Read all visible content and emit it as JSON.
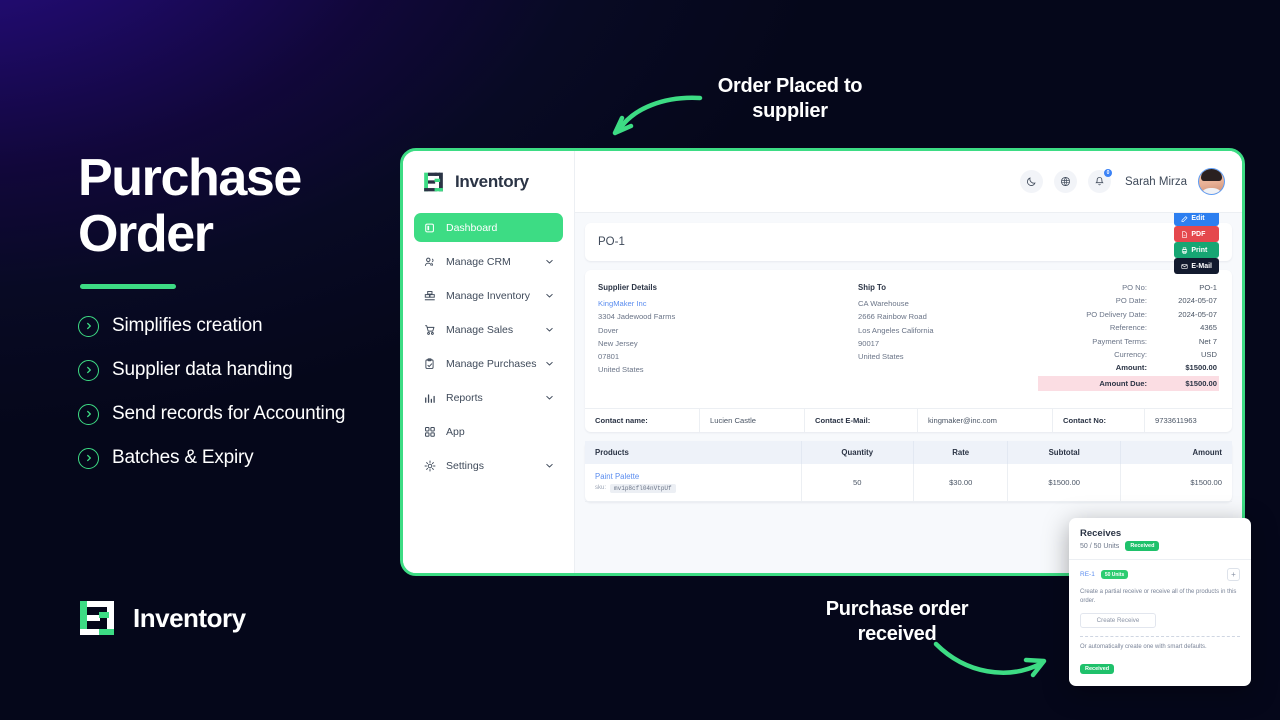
{
  "hero": {
    "title_line1": "Purchase",
    "title_line2": "Order",
    "features": [
      "Simplifies creation",
      "Supplier data handing",
      "Send records for Accounting",
      "Batches & Expiry"
    ]
  },
  "brand": {
    "name": "Inventory"
  },
  "annotations": {
    "top": "Order Placed to supplier",
    "bottom": "Purchase order received"
  },
  "app": {
    "logo_text": "Inventory",
    "nav": [
      {
        "label": "Dashboard",
        "icon": "dashboard-icon",
        "chevron": false,
        "active": true
      },
      {
        "label": "Manage CRM",
        "icon": "users-icon",
        "chevron": true,
        "active": false
      },
      {
        "label": "Manage Inventory",
        "icon": "boxes-icon",
        "chevron": true,
        "active": false
      },
      {
        "label": "Manage Sales",
        "icon": "cart-icon",
        "chevron": true,
        "active": false
      },
      {
        "label": "Manage Purchases",
        "icon": "clipboard-icon",
        "chevron": true,
        "active": false
      },
      {
        "label": "Reports",
        "icon": "bar-chart-icon",
        "chevron": true,
        "active": false
      },
      {
        "label": "App",
        "icon": "grid-icon",
        "chevron": false,
        "active": false
      },
      {
        "label": "Settings",
        "icon": "gear-icon",
        "chevron": true,
        "active": false
      }
    ],
    "topbar": {
      "user_name": "Sarah Mirza",
      "notification_count": "0",
      "icons": [
        "moon-icon",
        "language-icon",
        "bell-icon"
      ]
    }
  },
  "po": {
    "title": "PO-1",
    "actions": [
      {
        "label": "Edit",
        "icon": "pencil-icon",
        "color": "#2d7ff0"
      },
      {
        "label": "PDF",
        "icon": "file-icon",
        "color": "#e5484d"
      },
      {
        "label": "Print",
        "icon": "printer-icon",
        "color": "#17a673"
      },
      {
        "label": "E-Mail",
        "icon": "envelope-icon",
        "color": "#121a2e"
      }
    ],
    "supplier": {
      "heading": "Supplier Details",
      "name": "KingMaker Inc",
      "line1": "3304 Jadewood Farms",
      "line2": "Dover",
      "line3": "New Jersey",
      "line4": "07801",
      "line5": "United States"
    },
    "ship_to": {
      "heading": "Ship To",
      "name": "CA Warehouse",
      "line1": "2666 Rainbow Road",
      "line2": "Los Angeles California",
      "line3": "90017",
      "line4": "United States"
    },
    "meta": [
      {
        "key": "PO No:",
        "value": "PO-1",
        "bold": false,
        "due": false
      },
      {
        "key": "PO Date:",
        "value": "2024-05-07",
        "bold": false,
        "due": false
      },
      {
        "key": "PO Delivery Date:",
        "value": "2024-05-07",
        "bold": false,
        "due": false
      },
      {
        "key": "Reference:",
        "value": "4365",
        "bold": false,
        "due": false
      },
      {
        "key": "Payment Terms:",
        "value": "Net 7",
        "bold": false,
        "due": false
      },
      {
        "key": "Currency:",
        "value": "USD",
        "bold": false,
        "due": false
      },
      {
        "key": "Amount:",
        "value": "$1500.00",
        "bold": true,
        "due": false
      },
      {
        "key": "Amount Due:",
        "value": "$1500.00",
        "bold": true,
        "due": true
      }
    ],
    "contact": {
      "name_label": "Contact name:",
      "name_value": "Lucien Castle",
      "email_label": "Contact E-Mail:",
      "email_value": "kingmaker@inc.com",
      "phone_label": "Contact No:",
      "phone_value": "9733611963"
    },
    "products_table": {
      "headers": [
        "Products",
        "Quantity",
        "Rate",
        "Subtotal",
        "Amount"
      ],
      "rows": [
        {
          "product": "Paint Palette",
          "sku_label": "sku:",
          "sku_value": "mv1p8cfl04nVtpUf",
          "quantity": "50",
          "rate": "$30.00",
          "subtotal": "$1500.00",
          "amount": "$1500.00"
        }
      ]
    }
  },
  "receives": {
    "title": "Receives",
    "units": "50 / 50 Units",
    "status": "Received",
    "receive_id": "RE-1",
    "receive_units": "50 Units",
    "add_label": "+",
    "description": "Create a partial receive or receive all of the products in this order.",
    "button_label": "Create Receive",
    "auto_text": "Or automatically create one with smart defaults.",
    "auto_status": "Received"
  },
  "colors": {
    "accent_green": "#3ddc84",
    "status_green": "#1fc16b",
    "link_blue": "#5b8def",
    "due_bg": "#fbdde3"
  }
}
